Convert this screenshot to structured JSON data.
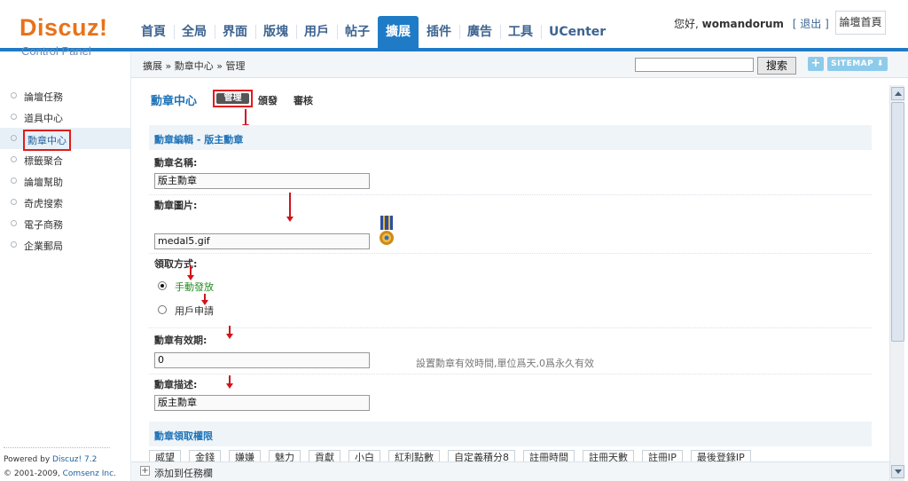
{
  "logo": {
    "brand": "Discuz!",
    "subtitle": "Control Panel"
  },
  "nav": {
    "tabs": [
      {
        "label": "首頁"
      },
      {
        "label": "全局"
      },
      {
        "label": "界面"
      },
      {
        "label": "版塊"
      },
      {
        "label": "用戶"
      },
      {
        "label": "帖子"
      },
      {
        "label": "擴展",
        "active": true
      },
      {
        "label": "插件"
      },
      {
        "label": "廣告"
      },
      {
        "label": "工具"
      },
      {
        "label": "UCenter"
      }
    ]
  },
  "user": {
    "greeting": "您好,",
    "name": "womandorum",
    "logout": "[ 退出 ]",
    "forum_home": "論壇首頁"
  },
  "breadcrumb": "擴展 » 勳章中心 » 管理",
  "search": {
    "value": "",
    "button": "搜索"
  },
  "toolbar": {
    "plus": "+",
    "sitemap": "SITEMAP ⬇"
  },
  "sidebar": {
    "items": [
      {
        "label": "論壇任務"
      },
      {
        "label": "道具中心"
      },
      {
        "label": "勳章中心",
        "active": true
      },
      {
        "label": "標籤聚合"
      },
      {
        "label": "論壇幫助"
      },
      {
        "label": "奇虎搜索"
      },
      {
        "label": "電子商務"
      },
      {
        "label": "企業郵局"
      }
    ],
    "powered_prefix": "Powered by ",
    "powered_name": "Discuz! 7.2",
    "copyright_prefix": "© 2001-2009, ",
    "copyright_name": "Comsenz Inc."
  },
  "content": {
    "title": "勳章中心",
    "tabs": {
      "manage": "管理",
      "issue": "頒發",
      "review": "審核"
    },
    "section_edit": "勳章編輯 - 版主勳章",
    "name_label": "勳章名稱:",
    "name_value": "版主勳章",
    "image_label": "勳章圖片:",
    "image_value": "medal5.gif",
    "method_label": "領取方式:",
    "method_manual": "手動發放",
    "method_apply": "用戶申請",
    "expire_label": "勳章有效期:",
    "expire_value": "0",
    "expire_hint": "設置勳章有效時間,單位爲天,0爲永久有效",
    "desc_label": "勳章描述:",
    "desc_value": "版主勳章",
    "section_perm": "勳章領取權限",
    "perm_buttons": [
      "威望",
      "金錢",
      "嫌嫌",
      "魅力",
      "貢獻",
      "小白",
      "紅利點數",
      "自定義積分8",
      "註冊時間",
      "註冊天數",
      "註冊IP",
      "最後登錄IP"
    ]
  },
  "bottombar": {
    "add_task": "添加到任務欄"
  },
  "colors": {
    "accent": "#1f7bc6",
    "highlight": "#e21b1b",
    "logo_orange": "#e8721a",
    "link_blue": "#1f73b7"
  }
}
